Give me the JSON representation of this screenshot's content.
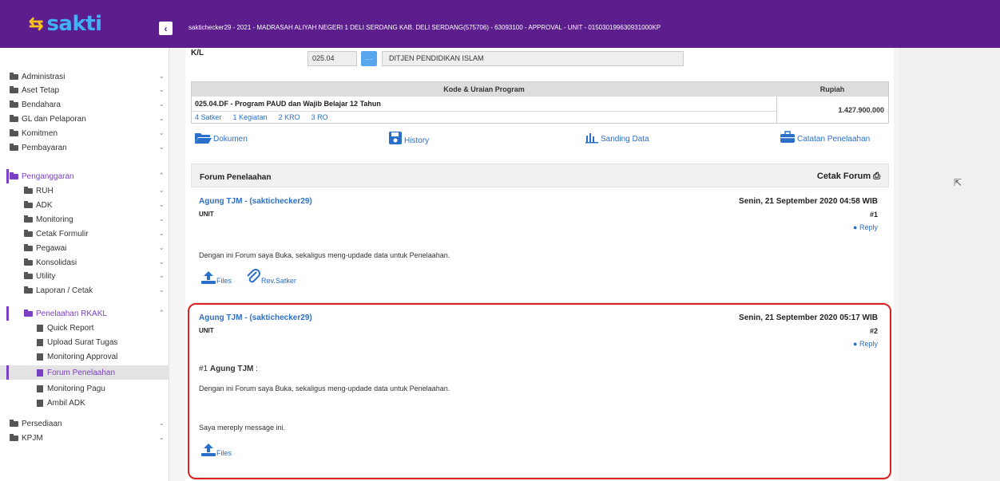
{
  "app": {
    "logo_text": "sakti",
    "topbar_title": "saktichecker29 - 2021 - MADRASAH ALIYAH NEGERI 1 DELI SERDANG KAB. DELI SERDANG(575706) - 63093100 - APPROVAL - UNIT - 015030199630931000KP",
    "collapse_icon": "‹"
  },
  "sidebar": {
    "items": [
      {
        "label": "Administrasi"
      },
      {
        "label": "Aset Tetap"
      },
      {
        "label": "Bendahara"
      },
      {
        "label": "GL dan Pelaporan"
      },
      {
        "label": "Komitmen"
      },
      {
        "label": "Pembayaran"
      },
      {
        "label": "Penganggaran"
      },
      {
        "label": "RUH"
      },
      {
        "label": "ADK"
      },
      {
        "label": "Monitoring"
      },
      {
        "label": "Cetak Formulir"
      },
      {
        "label": "Pegawai"
      },
      {
        "label": "Konsolidasi"
      },
      {
        "label": "Utility"
      },
      {
        "label": "Laporan / Cetak"
      },
      {
        "label": "Penelaahan RKAKL"
      },
      {
        "label": "Quick Report"
      },
      {
        "label": "Upload Surat Tugas"
      },
      {
        "label": "Monitoring Approval"
      },
      {
        "label": "Forum Penelaahan"
      },
      {
        "label": "Monitoring Pagu"
      },
      {
        "label": "Ambil ADK"
      },
      {
        "label": "Persediaan"
      },
      {
        "label": "KPJM"
      }
    ]
  },
  "header": {
    "kl_label": "K/L",
    "kl_code": "025.04",
    "kl_button": "···",
    "kl_name": "DITJEN PENDIDIKAN ISLAM"
  },
  "program": {
    "col_program": "Kode & Uraian Program",
    "col_rupiah": "Rupiah",
    "name": "025.04.DF - Program PAUD dan Wajib Belajar 12 Tahun",
    "links": [
      "4 Satker",
      "1 Kegiatan",
      "2 KRO",
      "3 RO"
    ],
    "value": "1.427.900.000"
  },
  "toolbar": {
    "dokumen": "Dokumen",
    "history": "History",
    "sanding": "Sanding Data",
    "catatan": "Catatan Penelaahan"
  },
  "forum": {
    "title": "Forum Penelaahan",
    "cetak": "Cetak Forum",
    "posts": [
      {
        "author": "Agung TJM - (saktichecker29)",
        "unit": "UNIT",
        "date": "Senin, 21 September 2020 04:58 WIB",
        "num": "#1",
        "reply": "Reply",
        "message": "Dengan ini Forum saya Buka, sekaligus meng-updade data untuk Penelaahan.",
        "files": "Files",
        "rev": "Rev.Satker"
      },
      {
        "author": "Agung TJM - (saktichecker29)",
        "unit": "UNIT",
        "date": "Senin, 21 September 2020 05:17 WIB",
        "num": "#2",
        "reply": "Reply",
        "quote_ref": "#1",
        "quote_author": "Agung TJM",
        "quote_colon": ":",
        "quote_msg": "Dengan ini Forum saya Buka, sekaligus meng-updade data untuk Penelaahan.",
        "message": "Saya mereply message ini.",
        "files": "Files"
      }
    ]
  },
  "colors": {
    "topbar": "#5b1e8c",
    "accent": "#7b3fc4",
    "link": "#2a6fc9",
    "highlight": "#e02020"
  }
}
